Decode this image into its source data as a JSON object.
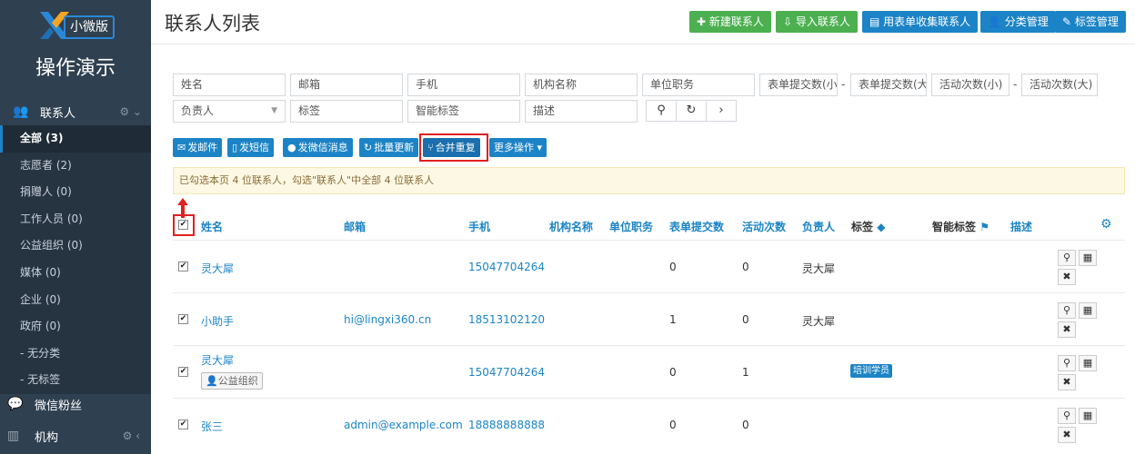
{
  "sidebar": {
    "logo_badge": "小微版",
    "app_title": "操作演示",
    "section": {
      "label": "联系人",
      "icon": "users-icon",
      "tools": "⚙ ⌄"
    },
    "items": [
      {
        "label": "全部 (3)",
        "active": true
      },
      {
        "label": "志愿者 (2)"
      },
      {
        "label": "捐赠人 (0)"
      },
      {
        "label": "工作人员 (0)"
      },
      {
        "label": "公益组织 (0)"
      },
      {
        "label": "媒体 (0)"
      },
      {
        "label": "企业 (0)"
      },
      {
        "label": "政府 (0)"
      },
      {
        "label": "- 无分类"
      },
      {
        "label": "- 无标签"
      }
    ],
    "wechat": {
      "label": "微信粉丝",
      "icon": "chat-icon"
    },
    "org": {
      "label": "机构",
      "icon": "building-icon",
      "tools": "⚙ ‹"
    }
  },
  "header": {
    "title": "联系人列表",
    "buttons": [
      {
        "label": "新建联系人",
        "icon": "plus-icon"
      },
      {
        "label": "导入联系人",
        "icon": "import-icon"
      },
      {
        "label": "用表单收集联系人",
        "icon": "form-icon"
      },
      {
        "label": "分类管理",
        "icon": "user-icon"
      },
      {
        "label": "标签管理",
        "icon": "tag-icon"
      }
    ]
  },
  "filters": {
    "name": "姓名",
    "email": "邮箱",
    "phone": "手机",
    "org": "机构名称",
    "position": "单位职务",
    "form_min": "表单提交数(小",
    "form_max": "表单提交数(大",
    "act_min": "活动次数(小)",
    "act_max": "活动次数(大)",
    "dash": "-",
    "owner": "负责人",
    "owner_arrow": "▼",
    "tags": "标签",
    "smart_tags": "智能标签",
    "desc": "描述",
    "search_icon": "⚲",
    "reset_icon": "↻",
    "next_icon": "›"
  },
  "actions": [
    {
      "label": "发邮件",
      "icon": "mail-icon",
      "glyph": "✉"
    },
    {
      "label": "发短信",
      "icon": "phone-icon",
      "glyph": "▯"
    },
    {
      "label": "发微信消息",
      "icon": "wechat-icon",
      "glyph": "●"
    },
    {
      "label": "批量更新",
      "icon": "refresh-icon",
      "glyph": "↻"
    },
    {
      "label": "合并重复",
      "icon": "merge-icon",
      "glyph": "⑂"
    },
    {
      "label": "更多操作",
      "icon": "caret-down-icon",
      "glyph": "▾"
    }
  ],
  "notice": "已勾选本页 4 位联系人，勾选\"联系人\"中全部 4 位联系人",
  "table": {
    "headers": {
      "name": "姓名",
      "email": "邮箱",
      "phone": "手机",
      "org": "机构名称",
      "position": "单位职务",
      "forms": "表单提交数",
      "activities": "活动次数",
      "owner": "负责人",
      "tags": "标签",
      "smart_tags": "智能标签",
      "desc": "描述"
    },
    "check_glyph": "✔",
    "rows": [
      {
        "name": "灵大犀",
        "email": "",
        "phone": "15047704264",
        "forms": "0",
        "activities": "0",
        "owner": "灵大犀",
        "tag": "",
        "org_tag": ""
      },
      {
        "name": "小助手",
        "email": "hi@lingxi360.cn",
        "phone": "18513102120",
        "forms": "1",
        "activities": "0",
        "owner": "灵大犀",
        "tag": "",
        "org_tag": ""
      },
      {
        "name": "灵大犀",
        "email": "",
        "phone": "15047704264",
        "forms": "0",
        "activities": "1",
        "owner": "",
        "tag": "培训学员",
        "org_tag": "公益组织"
      },
      {
        "name": "张三",
        "email": "admin@example.com",
        "phone": "18888888888",
        "forms": "0",
        "activities": "0",
        "owner": "",
        "tag": "",
        "org_tag": ""
      }
    ],
    "row_actions": {
      "view": "⚲",
      "qr": "▦",
      "delete": "✖"
    }
  },
  "colors": {
    "sidebar": "#2f4050",
    "accent": "#1c84c6",
    "green": "#4caf50",
    "highlight": "#e02020"
  }
}
